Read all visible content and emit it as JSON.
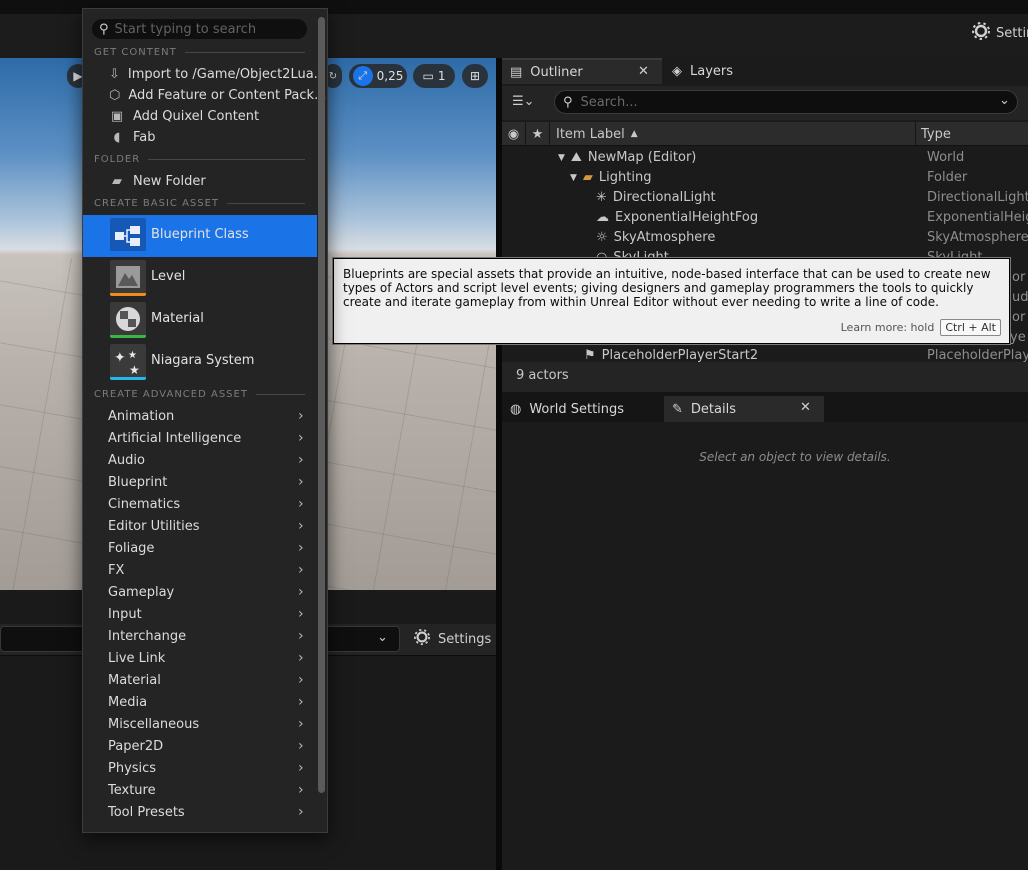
{
  "toolbar": {
    "settings_label": "Settin"
  },
  "viewport": {
    "scale_value": "0,25",
    "camera_speed": "1"
  },
  "bottom_panel": {
    "settings_label": "Settings"
  },
  "outliner": {
    "tab_label": "Outliner",
    "layers_label": "Layers",
    "search_placeholder": "Search...",
    "col_item_label": "Item Label",
    "col_type": "Type",
    "rows": [
      {
        "name": "NewMap (Editor)",
        "type": "World"
      },
      {
        "name": "Lighting",
        "type": "Folder"
      },
      {
        "name": "DirectionalLight",
        "type": "DirectionalLight"
      },
      {
        "name": "ExponentialHeightFog",
        "type": "ExponentialHeight"
      },
      {
        "name": "SkyAtmosphere",
        "type": "SkyAtmosphere"
      },
      {
        "name": "SkyLight",
        "type": "SkyLight"
      },
      {
        "name": "PlaceholderPlayerStart2",
        "type": "PlaceholderPlaye"
      }
    ],
    "partial_types": [
      "or",
      "ud",
      "or",
      "ye"
    ],
    "actor_count": "9 actors"
  },
  "details": {
    "world_settings_label": "World Settings",
    "details_label": "Details",
    "empty_text": "Select an object to view details."
  },
  "tooltip": {
    "text": "Blueprints are special assets that provide an intuitive, node-based interface that can be used to create new types of Actors and script level events; giving designers and gameplay programmers the tools to quickly create and iterate gameplay from within Unreal Editor without ever needing to write a line of code.",
    "learn_more": "Learn more: hold",
    "keys": "Ctrl + Alt"
  },
  "menu": {
    "search_placeholder": "Start typing to search",
    "sections": {
      "get_content": "GET CONTENT",
      "folder": "FOLDER",
      "basic": "CREATE BASIC ASSET",
      "advanced": "CREATE ADVANCED ASSET"
    },
    "get_content": [
      {
        "label": "Import to /Game/Object2Lua...",
        "icon": "import-icon"
      },
      {
        "label": "Add Feature or Content Pack...",
        "icon": "content-pack-icon"
      },
      {
        "label": "Add Quixel Content",
        "icon": "quixel-icon"
      },
      {
        "label": "Fab",
        "icon": "fab-icon"
      }
    ],
    "new_folder": "New Folder",
    "basic_assets": [
      {
        "label": "Blueprint Class",
        "color": "#1b73e8"
      },
      {
        "label": "Level",
        "color": "#f08a1c"
      },
      {
        "label": "Material",
        "color": "#3bb54a"
      },
      {
        "label": "Niagara System",
        "color": "#25b7e6"
      }
    ],
    "advanced_assets": [
      "Animation",
      "Artificial Intelligence",
      "Audio",
      "Blueprint",
      "Cinematics",
      "Editor Utilities",
      "Foliage",
      "FX",
      "Gameplay",
      "Input",
      "Interchange",
      "Live Link",
      "Material",
      "Media",
      "Miscellaneous",
      "Paper2D",
      "Physics",
      "Texture",
      "Tool Presets"
    ]
  }
}
